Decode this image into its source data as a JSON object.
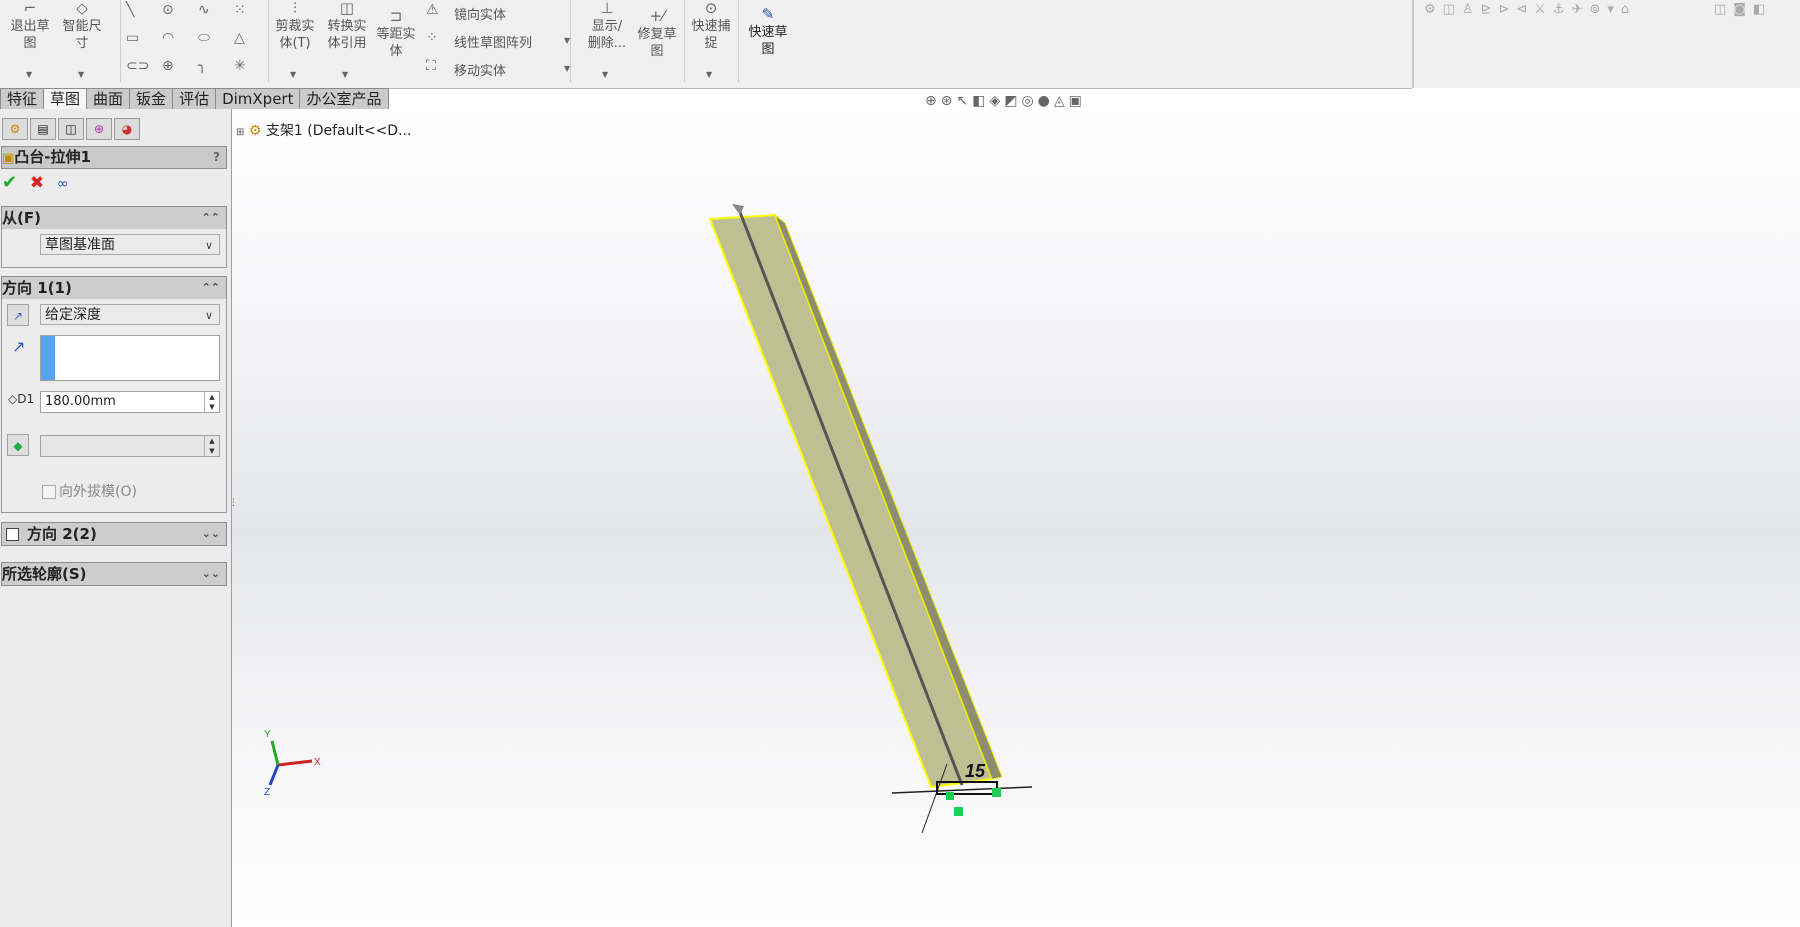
{
  "ribbon": {
    "exit_sketch": [
      "退出草",
      "图"
    ],
    "smart_dimension": [
      "智能尺",
      "寸"
    ],
    "trim_entities": [
      "剪裁实",
      "体(T)"
    ],
    "convert_entities": [
      "转换实",
      "体引用"
    ],
    "offset_entities": [
      "等距实",
      "体"
    ],
    "mirror_entities": "镜向实体",
    "linear_pattern": "线性草图阵列",
    "move_entities": "移动实体",
    "display_delete": [
      "显示/",
      "删除..."
    ],
    "repair_sketch": [
      "修复草",
      "图"
    ],
    "quick_snaps": [
      "快速捕",
      "捉"
    ],
    "rapid_sketch": [
      "快速草",
      "图"
    ]
  },
  "tabs": [
    {
      "label": "特征"
    },
    {
      "label": "草图",
      "active": true
    },
    {
      "label": "曲面"
    },
    {
      "label": "钣金"
    },
    {
      "label": "评估"
    },
    {
      "label": "DimXpert"
    },
    {
      "label": "办公室产品"
    }
  ],
  "property_manager": {
    "title": "凸台-拉伸1",
    "help": "?",
    "from_section": {
      "title": "从(F)",
      "start_condition": "草图基准面"
    },
    "direction1": {
      "title": "方向 1(1)",
      "end_condition": "给定深度",
      "depth": "180.00mm",
      "draft_outward": "向外拔模(O)"
    },
    "direction2": {
      "title": "方向 2(2)"
    },
    "selected_contours": {
      "title": "所选轮廓(S)"
    }
  },
  "tree": {
    "root": "支架1",
    "config": "(Default<<D..."
  },
  "triad": {
    "x": "X",
    "y": "Y",
    "z": "Z"
  },
  "dimension_label": "15"
}
